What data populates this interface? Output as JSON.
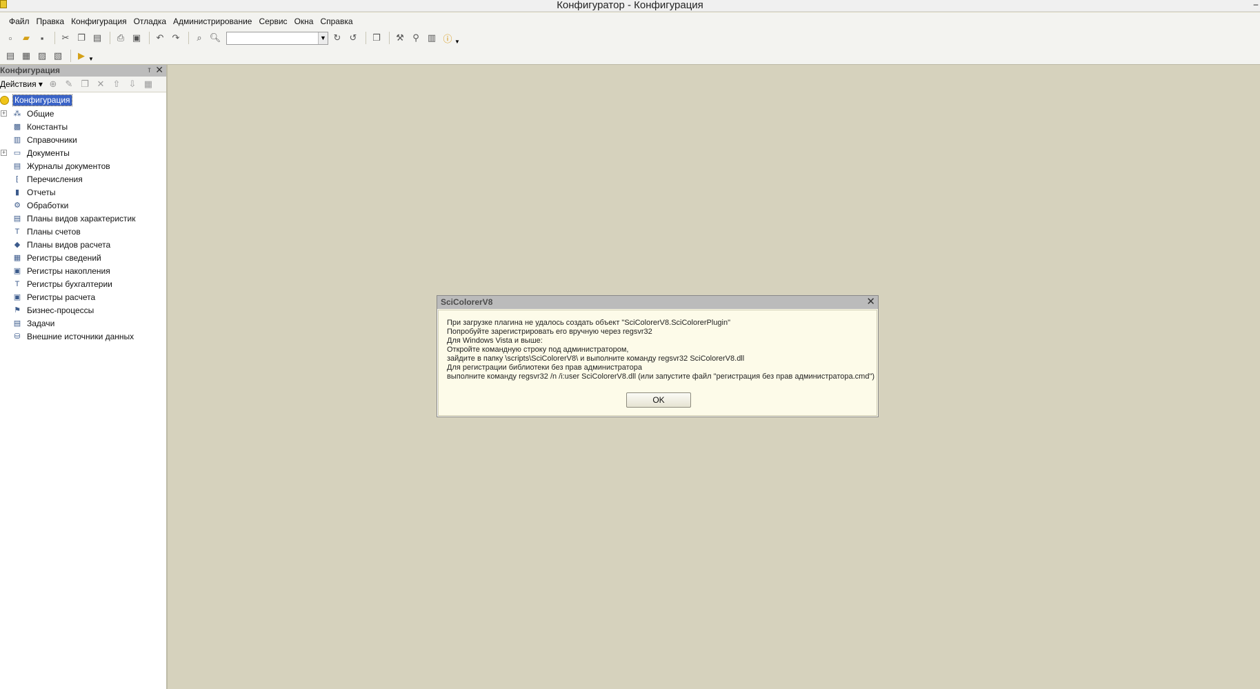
{
  "window": {
    "title": "Конфигуратор - Конфигурация"
  },
  "menu": [
    "Файл",
    "Правка",
    "Конфигурация",
    "Отладка",
    "Администрирование",
    "Сервис",
    "Окна",
    "Справка"
  ],
  "toolbar": {
    "icons": [
      "new-file-icon",
      "open-file-icon",
      "save-icon",
      "cut-icon",
      "copy-icon",
      "paste-icon",
      "print-icon",
      "print-preview-icon",
      "undo-icon",
      "redo-icon",
      "find-icon",
      "search-icon",
      "find-next-icon",
      "find-prev-icon",
      "windows-icon",
      "tools-icon",
      "syntax-helper-icon",
      "help-book-icon",
      "info-icon"
    ],
    "search_value": ""
  },
  "panel": {
    "title": "Конфигурация",
    "actions_label": "Действия",
    "root_label": "Конфигурация",
    "items": [
      {
        "label": "Общие",
        "icon": "common-icon",
        "expandable": true
      },
      {
        "label": "Константы",
        "icon": "constants-icon",
        "expandable": false
      },
      {
        "label": "Справочники",
        "icon": "catalogs-icon",
        "expandable": false
      },
      {
        "label": "Документы",
        "icon": "documents-icon",
        "expandable": true
      },
      {
        "label": "Журналы документов",
        "icon": "document-journals-icon",
        "expandable": false
      },
      {
        "label": "Перечисления",
        "icon": "enums-icon",
        "expandable": false
      },
      {
        "label": "Отчеты",
        "icon": "reports-icon",
        "expandable": false
      },
      {
        "label": "Обработки",
        "icon": "data-processors-icon",
        "expandable": false
      },
      {
        "label": "Планы видов характеристик",
        "icon": "chart-of-characteristic-types-icon",
        "expandable": false
      },
      {
        "label": "Планы счетов",
        "icon": "chart-of-accounts-icon",
        "expandable": false
      },
      {
        "label": "Планы видов расчета",
        "icon": "chart-of-calculation-types-icon",
        "expandable": false
      },
      {
        "label": "Регистры сведений",
        "icon": "information-registers-icon",
        "expandable": false
      },
      {
        "label": "Регистры накопления",
        "icon": "accumulation-registers-icon",
        "expandable": false
      },
      {
        "label": "Регистры бухгалтерии",
        "icon": "accounting-registers-icon",
        "expandable": false
      },
      {
        "label": "Регистры расчета",
        "icon": "calculation-registers-icon",
        "expandable": false
      },
      {
        "label": "Бизнес-процессы",
        "icon": "business-processes-icon",
        "expandable": false
      },
      {
        "label": "Задачи",
        "icon": "tasks-icon",
        "expandable": false
      },
      {
        "label": "Внешние источники данных",
        "icon": "external-data-sources-icon",
        "expandable": false
      }
    ]
  },
  "dialog": {
    "title": "SciColorerV8",
    "lines": [
      "При загрузке плагина не удалось создать объект \"SciColorerV8.SciColorerPlugin\"",
      "Попробуйте зарегистрировать его вручную через regsvr32",
      "Для Windows Vista и выше:",
      "Откройте командную строку под администратором,",
      "зайдите в папку \\scripts\\SciColorerV8\\ и выполните команду regsvr32 SciColorerV8.dll",
      "Для регистрации библиотеки без прав администратора",
      "выполните команду regsvr32 /n /i:user SciColorerV8.dll (или запустите файл \"регистрация без прав администратора.cmd\")"
    ],
    "ok_label": "OK"
  },
  "colors": {
    "workspace": "#d6d2bd",
    "selection": "#3a63c7",
    "dialog_bg": "#fdfbe9"
  }
}
